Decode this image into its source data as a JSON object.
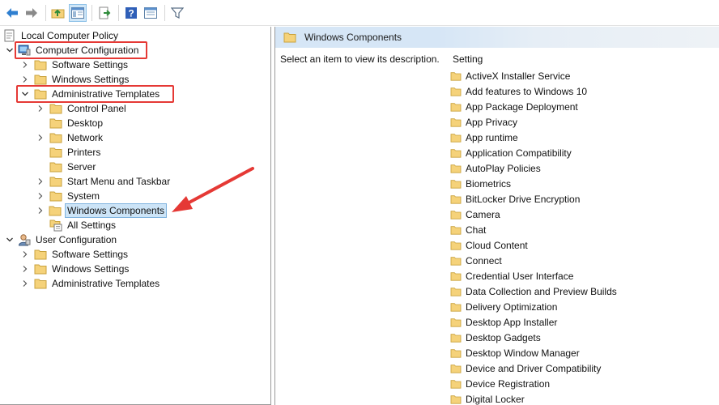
{
  "toolbar": {
    "buttons": [
      "back-icon",
      "forward-icon",
      "up-folder-icon",
      "show-hide-tree-icon",
      "export-list-icon",
      "help-icon",
      "extended-view-icon",
      "filter-icon"
    ]
  },
  "tree": {
    "root": "Local Computer Policy",
    "computer_configuration": "Computer Configuration",
    "cc_software_settings": "Software Settings",
    "cc_windows_settings": "Windows Settings",
    "cc_admin_templates": "Administrative Templates",
    "control_panel": "Control Panel",
    "desktop": "Desktop",
    "network": "Network",
    "printers": "Printers",
    "server": "Server",
    "start_menu": "Start Menu and Taskbar",
    "system": "System",
    "windows_components": "Windows Components",
    "all_settings": "All Settings",
    "user_configuration": "User Configuration",
    "uc_software_settings": "Software Settings",
    "uc_windows_settings": "Windows Settings",
    "uc_admin_templates": "Administrative Templates"
  },
  "right": {
    "header_title": "Windows Components",
    "description": "Select an item to view its description.",
    "column_header": "Setting",
    "settings": [
      "ActiveX Installer Service",
      "Add features to Windows 10",
      "App Package Deployment",
      "App Privacy",
      "App runtime",
      "Application Compatibility",
      "AutoPlay Policies",
      "Biometrics",
      "BitLocker Drive Encryption",
      "Camera",
      "Chat",
      "Cloud Content",
      "Connect",
      "Credential User Interface",
      "Data Collection and Preview Builds",
      "Delivery Optimization",
      "Desktop App Installer",
      "Desktop Gadgets",
      "Desktop Window Manager",
      "Device and Driver Compatibility",
      "Device Registration",
      "Digital Locker"
    ]
  },
  "colors": {
    "folder_fill": "#f5d27a",
    "folder_stroke": "#c9a23c",
    "highlight_red": "#e53935",
    "selection_bg": "#cce4f7",
    "header_bg": "#d6e6f6"
  }
}
